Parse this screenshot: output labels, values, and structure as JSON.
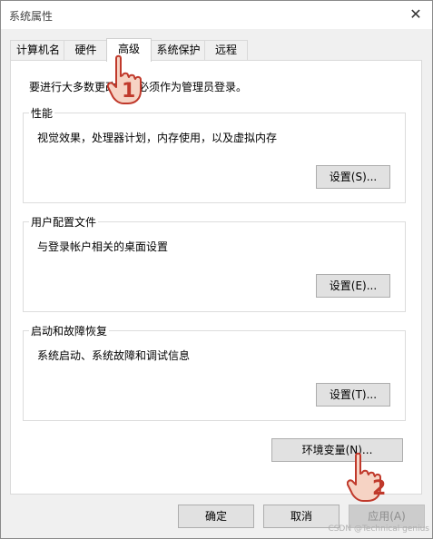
{
  "window": {
    "title": "系统属性",
    "close_glyph": "✕"
  },
  "tabs": [
    {
      "label": "计算机名"
    },
    {
      "label": "硬件"
    },
    {
      "label": "高级"
    },
    {
      "label": "系统保护"
    },
    {
      "label": "远程"
    }
  ],
  "panel": {
    "notice": "要进行大多数更改，你必须作为管理员登录。",
    "groups": [
      {
        "title": "性能",
        "desc": "视觉效果，处理器计划，内存使用，以及虚拟内存",
        "button": "设置(S)..."
      },
      {
        "title": "用户配置文件",
        "desc": "与登录帐户相关的桌面设置",
        "button": "设置(E)..."
      },
      {
        "title": "启动和故障恢复",
        "desc": "系统启动、系统故障和调试信息",
        "button": "设置(T)..."
      }
    ],
    "env_button": "环境变量(N)..."
  },
  "footer": {
    "ok": "确定",
    "cancel": "取消",
    "apply": "应用(A)"
  },
  "annotations": {
    "step1": "1",
    "step2": "2",
    "accent": "#c0392b"
  },
  "watermark": "CSDN @Technical genius"
}
